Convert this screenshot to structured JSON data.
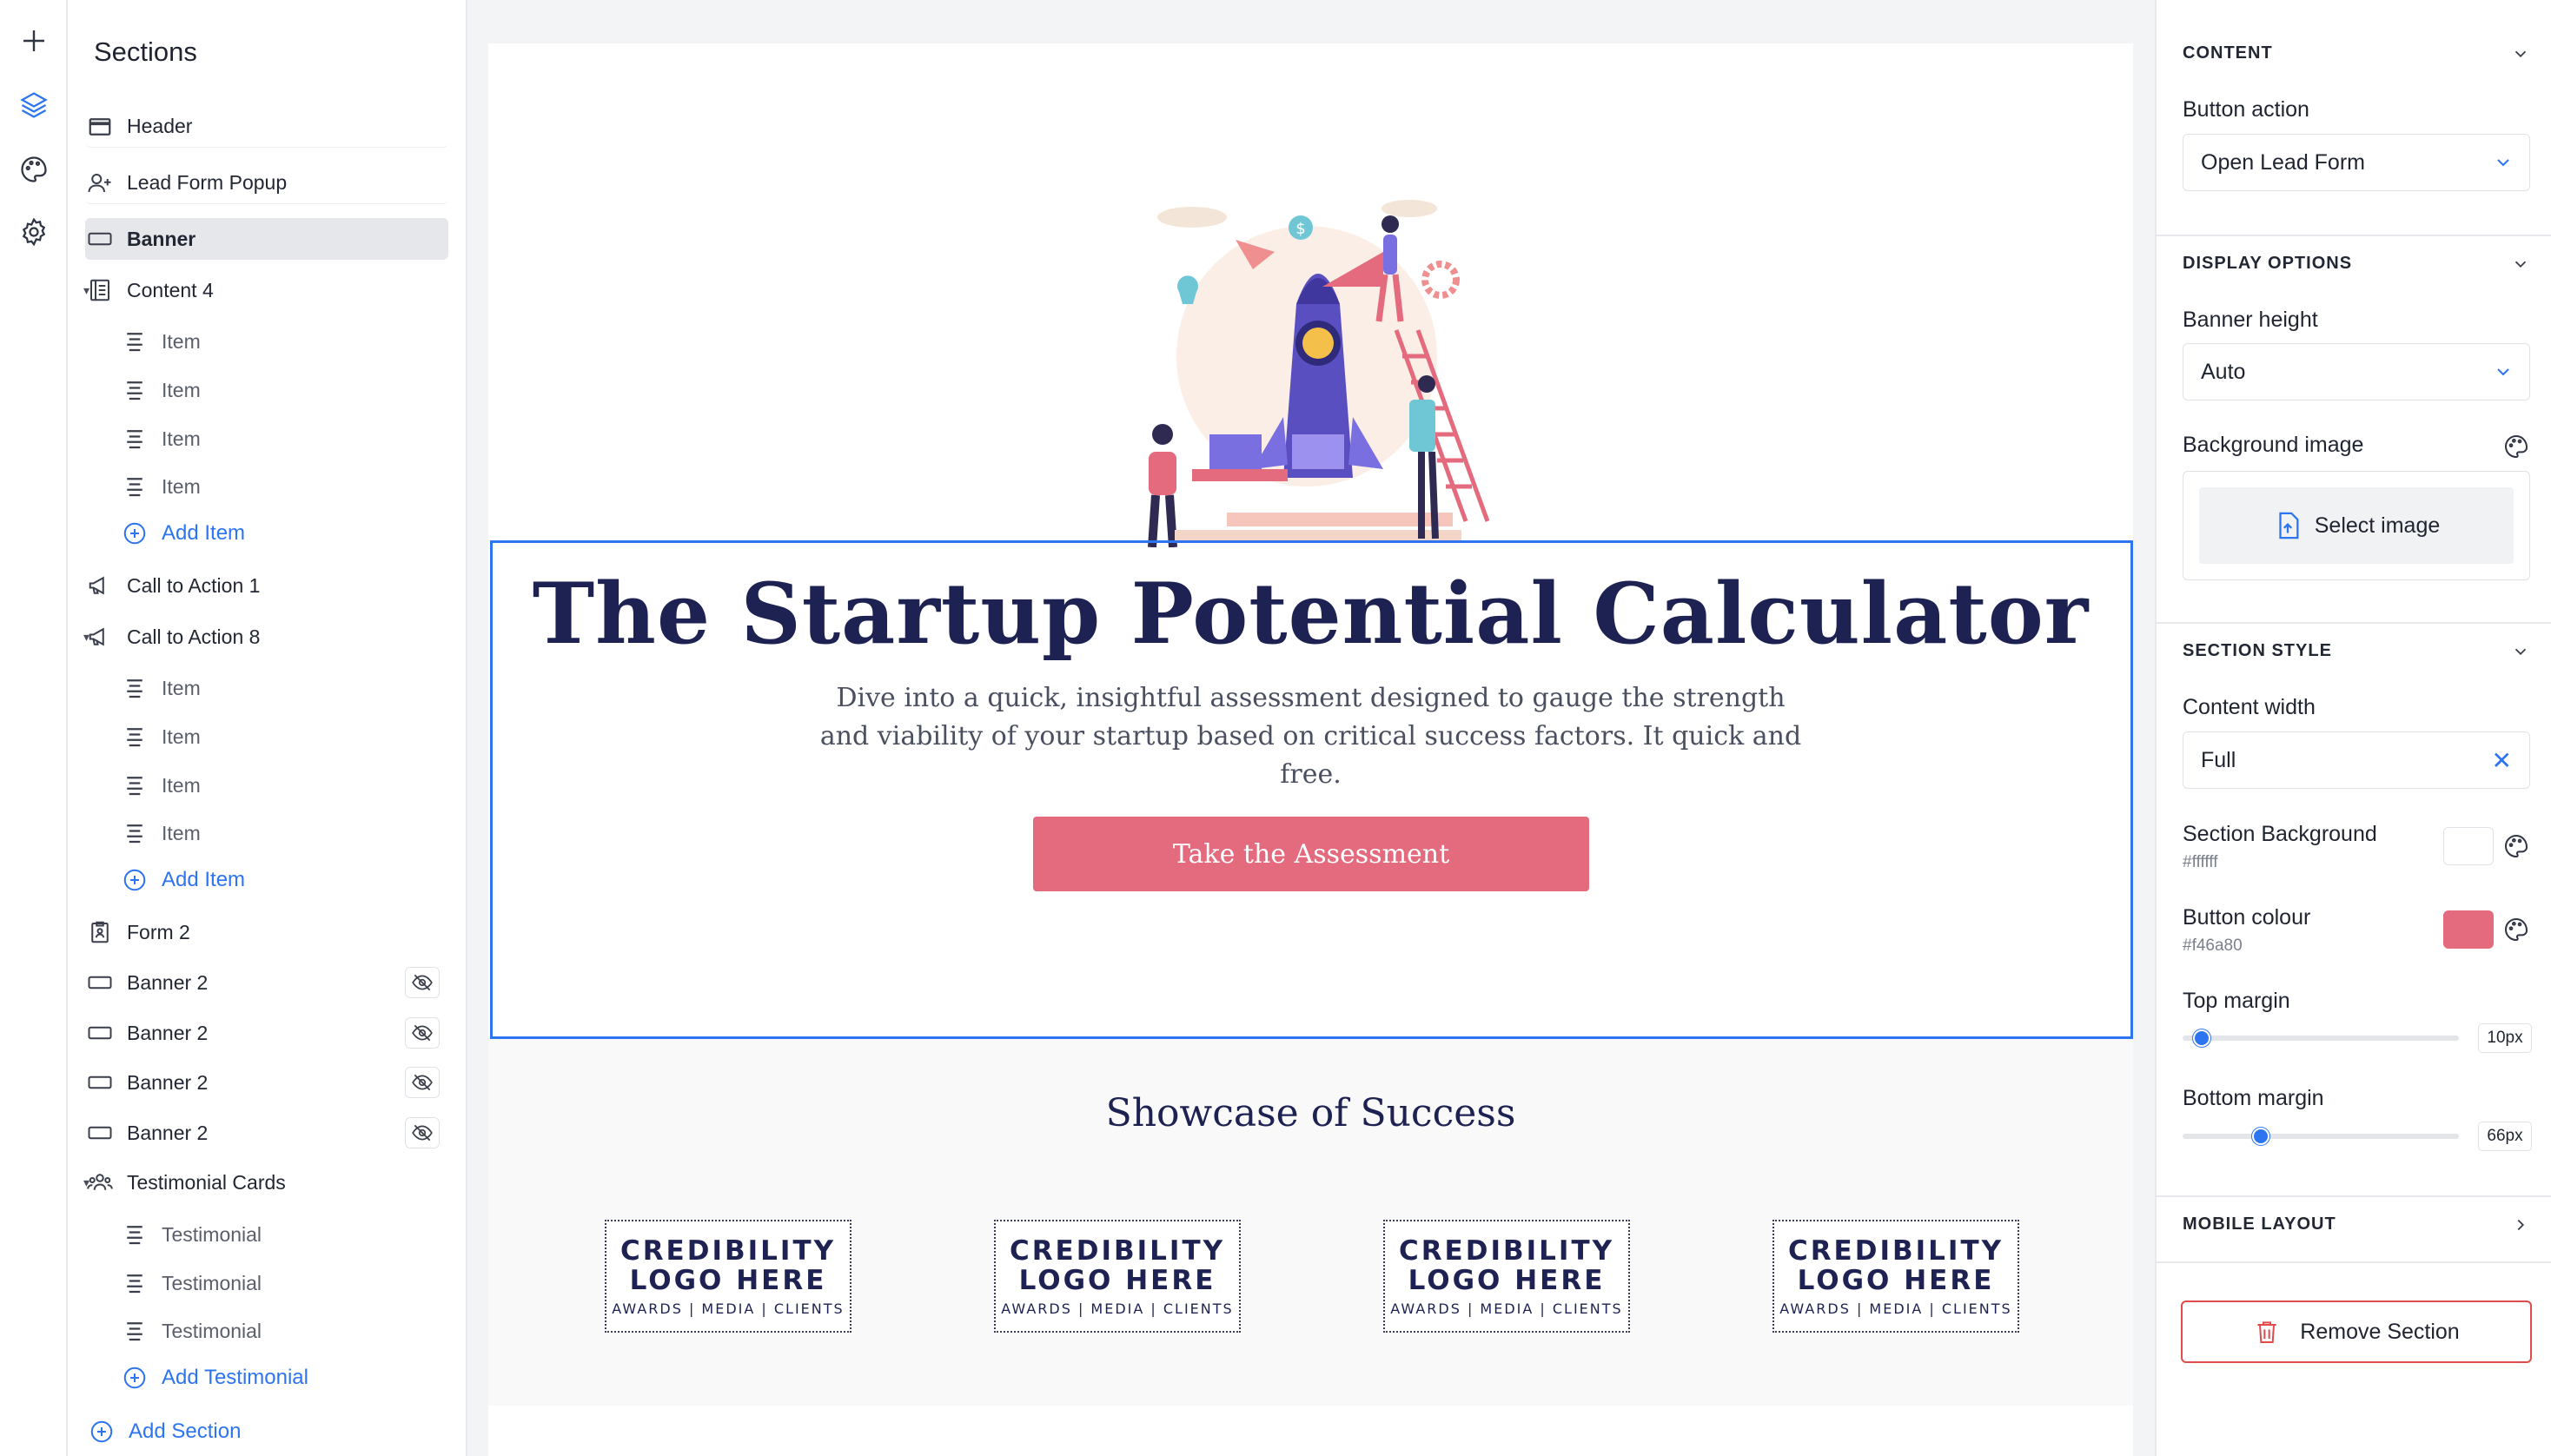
{
  "rail": {
    "icons": [
      "plus-icon",
      "layers-icon",
      "palette-icon",
      "settings-icon"
    ]
  },
  "sidebar": {
    "title": "Sections",
    "items": [
      {
        "label": "Header",
        "icon": "header-icon"
      },
      {
        "label": "Lead Form Popup",
        "icon": "user-plus-icon"
      },
      {
        "label": "Banner",
        "icon": "banner-icon"
      },
      {
        "label": "Content 4",
        "icon": "content-icon"
      },
      {
        "label": "Item"
      },
      {
        "label": "Item"
      },
      {
        "label": "Item"
      },
      {
        "label": "Item"
      },
      {
        "label": "Add Item"
      },
      {
        "label": "Call to Action 1",
        "icon": "megaphone-icon"
      },
      {
        "label": "Call to Action 8",
        "icon": "megaphone-icon"
      },
      {
        "label": "Item"
      },
      {
        "label": "Item"
      },
      {
        "label": "Item"
      },
      {
        "label": "Item"
      },
      {
        "label": "Add Item"
      },
      {
        "label": "Form 2",
        "icon": "form-icon"
      },
      {
        "label": "Banner 2",
        "icon": "banner-icon"
      },
      {
        "label": "Banner 2",
        "icon": "banner-icon"
      },
      {
        "label": "Banner 2",
        "icon": "banner-icon"
      },
      {
        "label": "Banner 2",
        "icon": "banner-icon"
      },
      {
        "label": "Testimonial Cards",
        "icon": "users-icon"
      },
      {
        "label": "Testimonial"
      },
      {
        "label": "Testimonial"
      },
      {
        "label": "Testimonial"
      },
      {
        "label": "Add Testimonial"
      },
      {
        "label": "Add Section"
      }
    ]
  },
  "canvas": {
    "hero_title": "The Startup Potential Calculator",
    "hero_subtitle": "Dive into a quick, insightful assessment designed to gauge the strength and viability of your startup based on critical success factors. It quick and free.",
    "cta_label": "Take the Assessment",
    "showcase_title": "Showcase of Success",
    "logos": [
      {
        "line1": "CREDIBILITY",
        "line2": "LOGO HERE",
        "line3": "AWARDS | MEDIA | CLIENTS"
      },
      {
        "line1": "CREDIBILITY",
        "line2": "LOGO HERE",
        "line3": "AWARDS | MEDIA | CLIENTS"
      },
      {
        "line1": "CREDIBILITY",
        "line2": "LOGO HERE",
        "line3": "AWARDS | MEDIA | CLIENTS"
      },
      {
        "line1": "CREDIBILITY",
        "line2": "LOGO HERE",
        "line3": "AWARDS | MEDIA | CLIENTS"
      }
    ]
  },
  "panel": {
    "content": {
      "heading": "CONTENT",
      "button_action_label": "Button action",
      "button_action_value": "Open Lead Form"
    },
    "display": {
      "heading": "DISPLAY OPTIONS",
      "banner_height_label": "Banner height",
      "banner_height_value": "Auto",
      "background_image_label": "Background image",
      "select_image_label": "Select image"
    },
    "style": {
      "heading": "SECTION STYLE",
      "content_width_label": "Content width",
      "content_width_value": "Full",
      "section_bg_label": "Section Background",
      "section_bg_value": "#ffffff",
      "button_colour_label": "Button colour",
      "button_colour_value": "#f46a80",
      "top_margin_label": "Top margin",
      "top_margin_value": "10px",
      "top_margin_fraction": 0.04,
      "bottom_margin_label": "Bottom margin",
      "bottom_margin_value": "66px",
      "bottom_margin_fraction": 0.27
    },
    "mobile": {
      "heading": "MOBILE LAYOUT"
    },
    "remove_label": "Remove Section"
  },
  "colors": {
    "accent": "#2d74f0",
    "button": "#e46a7e",
    "title": "#1d2252",
    "danger": "#e04b4b"
  }
}
